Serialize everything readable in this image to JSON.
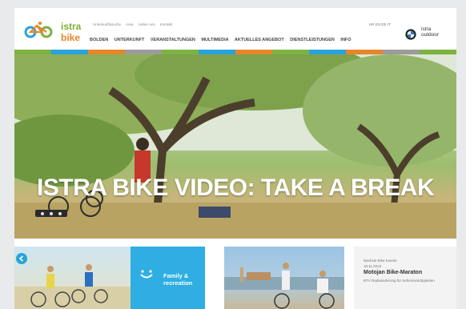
{
  "logo": {
    "line1": "istra",
    "line2": "bike"
  },
  "top_links": [
    "Unterkunftssuche",
    "Area",
    "Ueber uns",
    "Kontakt"
  ],
  "language": "HR EN DE IT",
  "nav": [
    "BOLDEN",
    "UNTERKUNFT",
    "VERANSTALTUNGEN",
    "MULTIMEDIA",
    "AKTUELLES ANGEBOT",
    "DIENSTLEISTUNGEN",
    "INFO"
  ],
  "partner": {
    "line1": "istra",
    "line2": "outdoor"
  },
  "stripe_colors": [
    "#7cb342",
    "#29a3dc",
    "#e5862a",
    "#9c9c9c",
    "#7cb342",
    "#29a3dc",
    "#e5862a",
    "#7cb342",
    "#29a3dc",
    "#e5862a",
    "#9c9c9c",
    "#7cb342"
  ],
  "hero": {
    "title": "ISTRA BIKE VIDEO: TAKE A BREAK",
    "slides": 3
  },
  "tiles": {
    "family": {
      "line1": "Family &",
      "line2": "recreation"
    },
    "event": {
      "label": "Nächste Bike Events",
      "date": "18.11.2016",
      "title": "Motojan Bike-Maraton",
      "subtitle": "BTV Radwanderung für Sehenswürdigkeiten"
    }
  },
  "accent": {
    "blue": "#29a3dc",
    "green": "#7cb342",
    "orange": "#e5862a"
  }
}
